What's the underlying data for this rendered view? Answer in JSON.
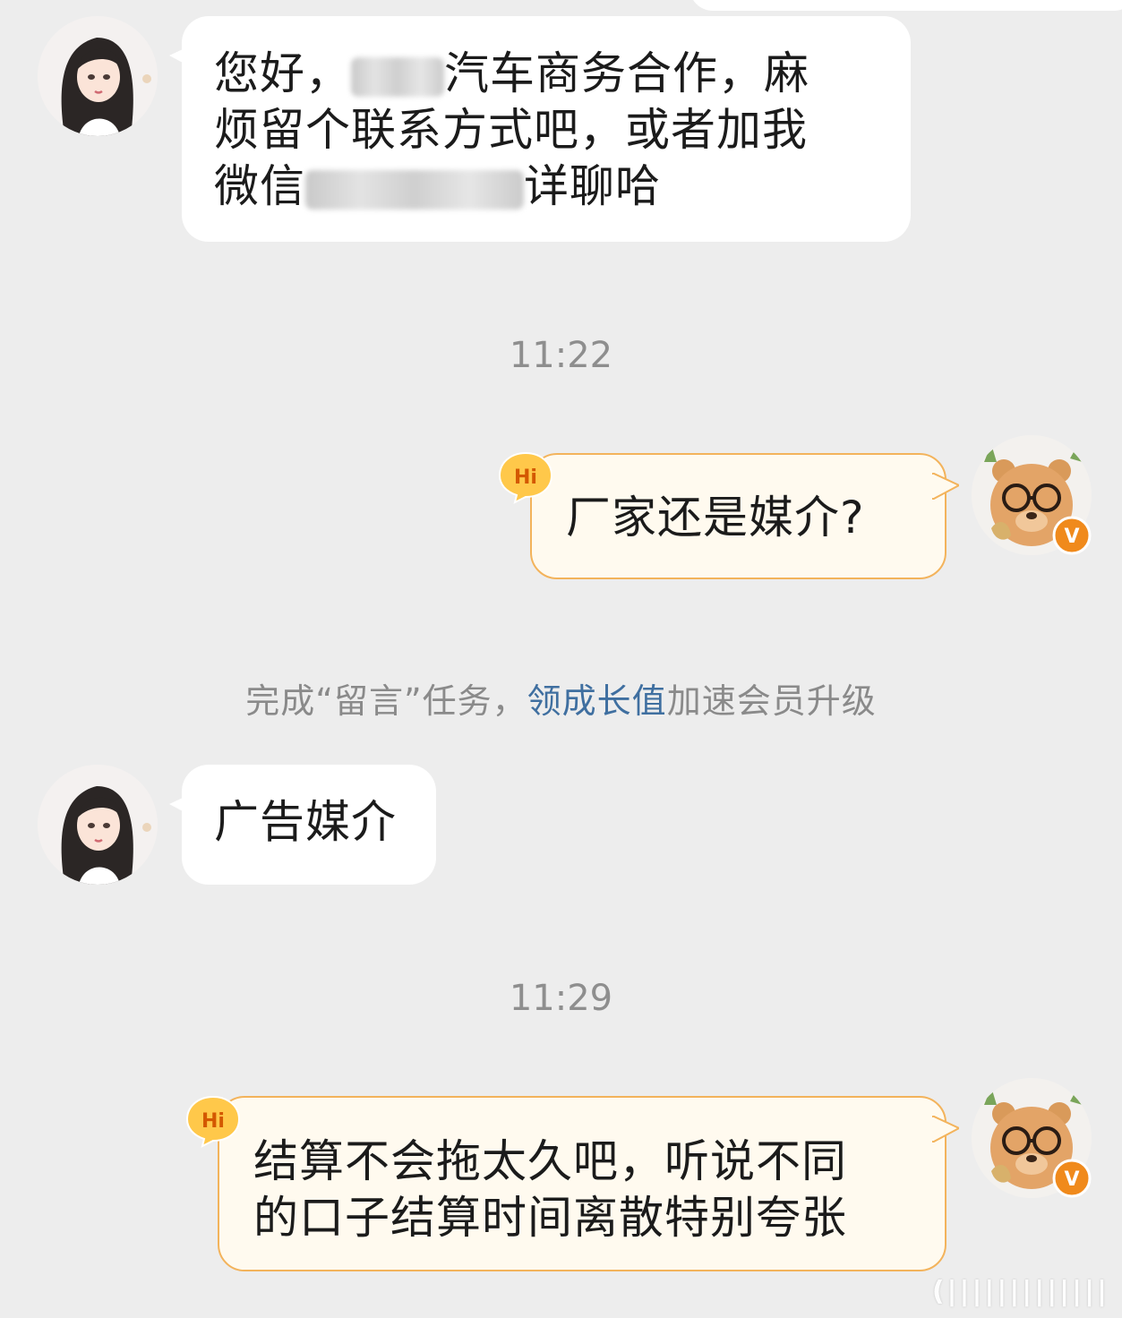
{
  "messages": [
    {
      "id": "m1",
      "side": "left",
      "segments": [
        "您好，",
        "",
        "汽车商务合作，麻",
        "烦留个联系方式吧，或者加我",
        "微信",
        "",
        "详聊哈"
      ]
    },
    {
      "id": "m2",
      "side": "right",
      "text": "厂家还是媒介?"
    },
    {
      "id": "m3",
      "side": "left",
      "text": "广告媒介"
    },
    {
      "id": "m4",
      "side": "right",
      "line1": "结算不会拖太久吧，听说不同",
      "line2": "的口子结算时间离散特别夸张"
    }
  ],
  "timestamps": [
    "11:22",
    "11:29"
  ],
  "notice": {
    "before": "完成“留言”任务，",
    "link": "领成长值",
    "after": "加速会员升级"
  },
  "badges": {
    "hi_label": "Hi",
    "verified_label": "V"
  },
  "watermark_text": "(|||||||||||||",
  "colors": {
    "background": "#ededed",
    "incoming_bubble": "#ffffff",
    "outgoing_bubble": "#fffaef",
    "outgoing_border": "#f3b35b",
    "link": "#3f6fa0",
    "verified": "#f08a1c"
  },
  "icons": {
    "left_avatar": "woman-illustration-avatar",
    "right_avatar": "bear-with-glasses-avatar",
    "hi_badge": "hi-speech-badge",
    "verified_badge": "orange-v-badge"
  }
}
